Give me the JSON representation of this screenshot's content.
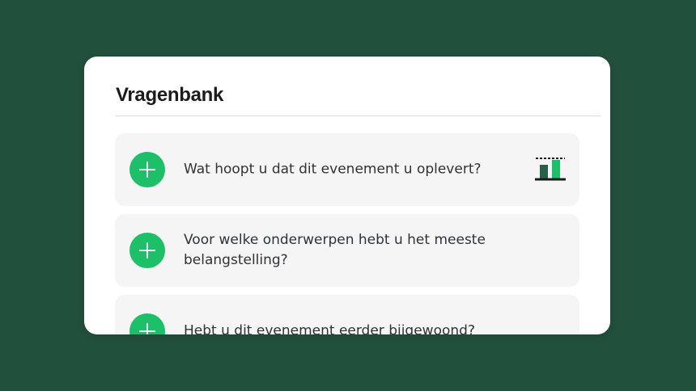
{
  "panel": {
    "title": "Vragenbank"
  },
  "questions": [
    {
      "text": "Wat hoopt u dat dit evenement u oplevert?",
      "action_icon": "plus-icon",
      "type_icon": "bar-chart-icon"
    },
    {
      "text": "Voor welke onderwerpen hebt u het meeste belangstelling?",
      "action_icon": "plus-icon"
    },
    {
      "text": "Hebt u dit evenement eerder bijgewoond?",
      "action_icon": "plus-icon"
    }
  ],
  "colors": {
    "background": "#21503c",
    "card": "#ffffff",
    "item_background": "#f5f5f5",
    "accent": "#1dbf68",
    "text": "#2f3337",
    "title": "#1b1b1b"
  }
}
